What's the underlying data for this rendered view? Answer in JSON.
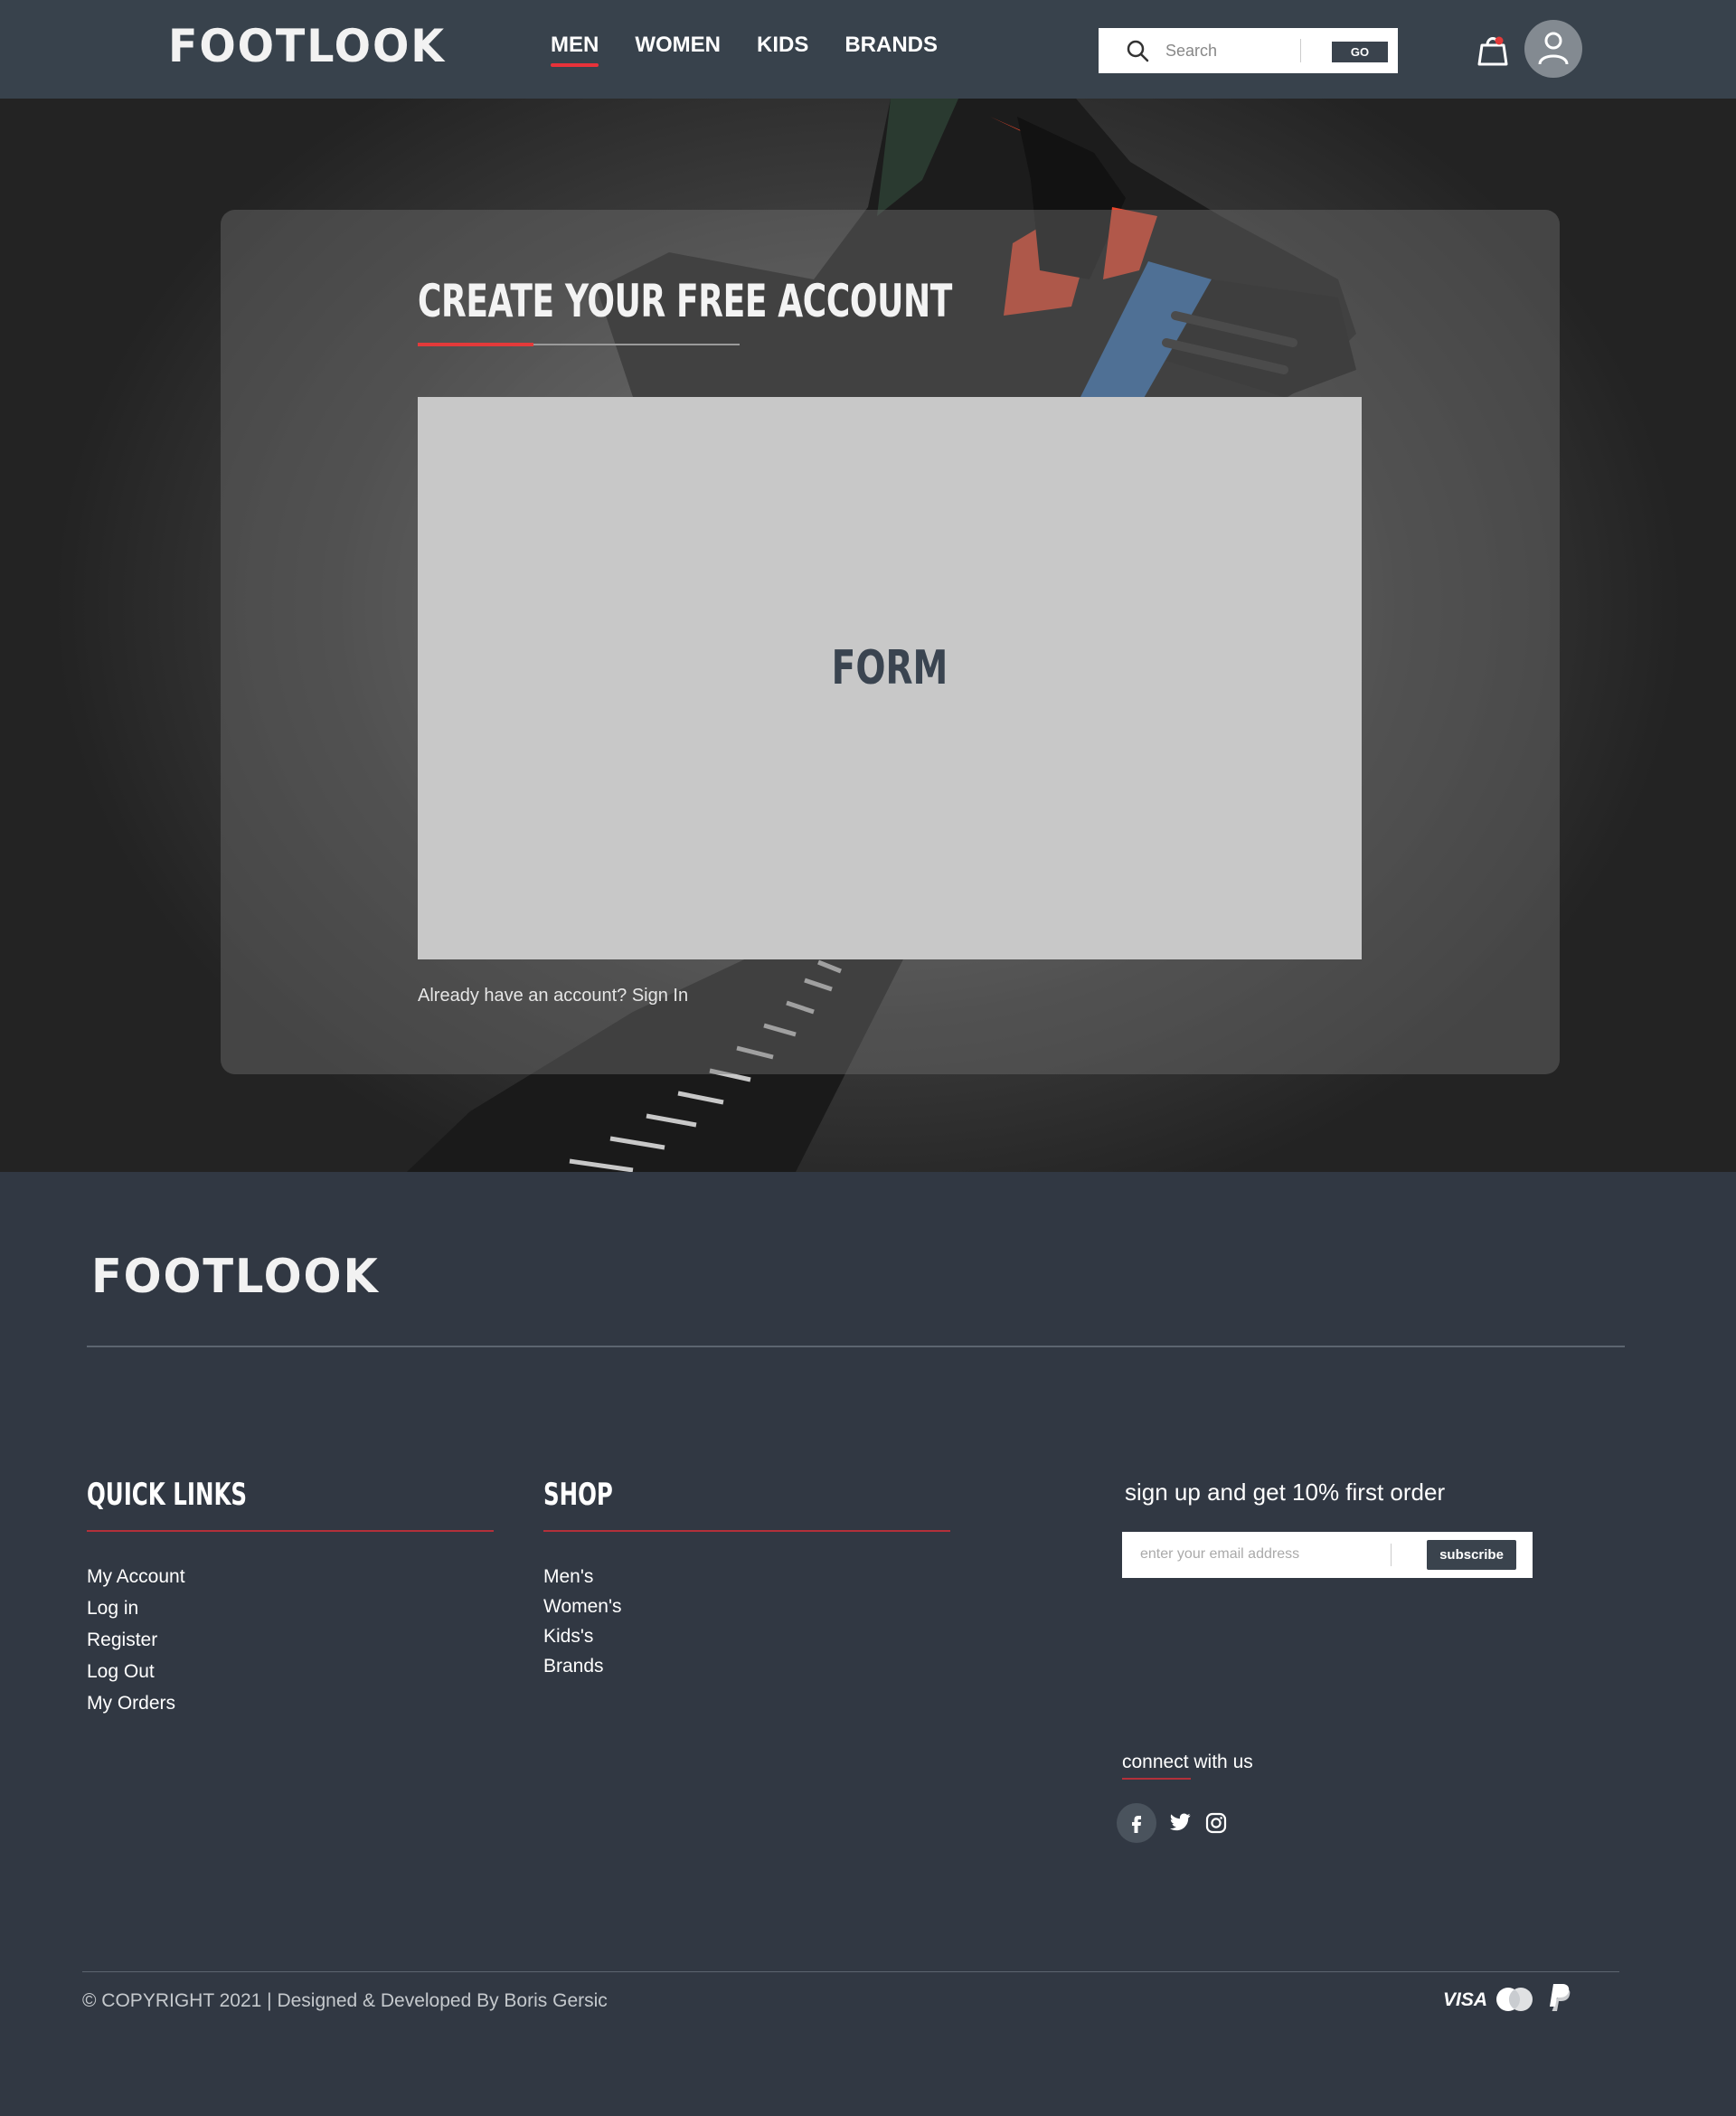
{
  "brand": "FOOTLOOK",
  "nav": {
    "items": [
      {
        "label": "MEN",
        "active": true
      },
      {
        "label": "WOMEN",
        "active": false
      },
      {
        "label": "KIDS",
        "active": false
      },
      {
        "label": "BRANDS",
        "active": false
      }
    ]
  },
  "search": {
    "placeholder": "Search",
    "button_label": "GO"
  },
  "header_icons": {
    "cart": "shopping-bag-icon",
    "user": "user-icon"
  },
  "hero": {
    "title": "CREATE YOUR FREE ACCOUNT",
    "form_placeholder": "FORM",
    "signin_prompt": "Already have an account?",
    "signin_link": "Sign In"
  },
  "footer": {
    "brand": "FOOTLOOK",
    "quick_links": {
      "title": "QUICK LINKS",
      "items": [
        "My Account",
        "Log in",
        "Register",
        "Log Out",
        "My Orders"
      ]
    },
    "shop": {
      "title": "SHOP",
      "items": [
        "Men's",
        "Women's",
        "Kids's",
        "Brands"
      ]
    },
    "newsletter": {
      "title": "sign up and get 10% first order",
      "placeholder": "enter your email address",
      "button_label": "subscribe"
    },
    "connect": {
      "title": "connect with us",
      "icons": [
        "facebook-icon",
        "twitter-icon",
        "instagram-icon"
      ]
    },
    "copyright": "© COPYRIGHT 2021 | Designed & Developed By Boris Gersic",
    "payment": {
      "visa_label": "VISA",
      "icons": [
        "visa-icon",
        "mastercard-icon",
        "paypal-icon"
      ]
    }
  },
  "colors": {
    "header_bg": "#38424c",
    "footer_bg": "#313843",
    "accent_red": "#e33a3a",
    "form_bg": "#c8c8c8",
    "button_dark": "#3a434d"
  }
}
